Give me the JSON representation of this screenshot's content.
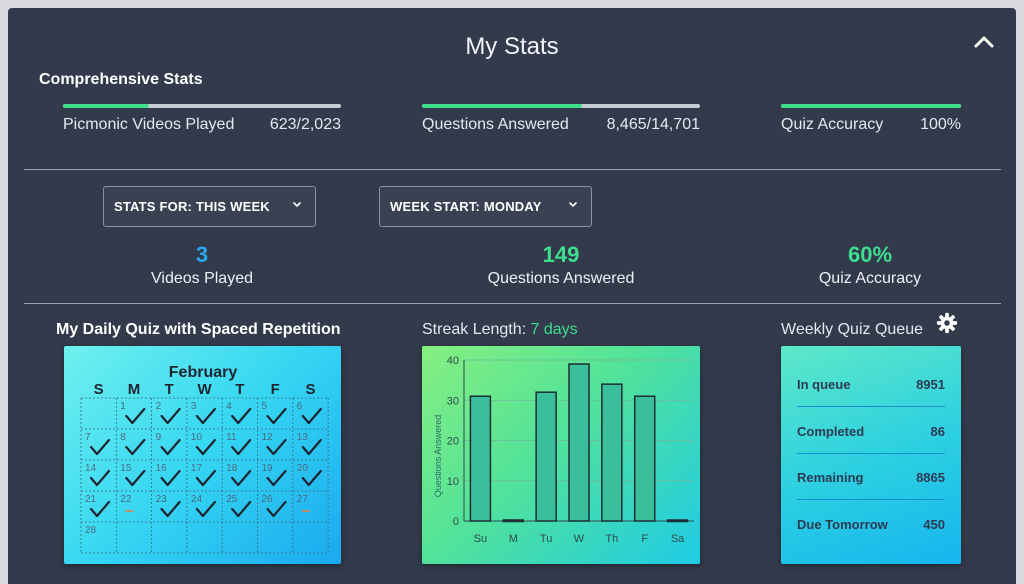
{
  "header": {
    "title": "My Stats"
  },
  "comprehensive": {
    "heading": "Comprehensive Stats",
    "metrics": [
      {
        "label": "Picmonic Videos Played",
        "value": "623/2,023",
        "progress": 0.308
      },
      {
        "label": "Questions Answered",
        "value": "8,465/14,701",
        "progress": 0.576
      },
      {
        "label": "Quiz Accuracy",
        "value": "100%",
        "progress": 1.0
      }
    ]
  },
  "filters": {
    "stats_for": "STATS FOR: THIS WEEK",
    "week_start": "WEEK START: MONDAY"
  },
  "weekly": {
    "videos_played": {
      "value": "3",
      "label": "Videos Played",
      "color": "#2aa7ef"
    },
    "questions_answered": {
      "value": "149",
      "label": "Questions Answered",
      "color": "#3ddf8e"
    },
    "quiz_accuracy": {
      "value": "60%",
      "label": "Quiz Accuracy",
      "color": "#3ddf8e"
    }
  },
  "calendar": {
    "title": "My Daily Quiz with Spaced Repetition",
    "month": "February",
    "weekdays": [
      "S",
      "M",
      "T",
      "W",
      "T",
      "F",
      "S"
    ],
    "days": [
      {
        "d": "1",
        "s": "done"
      },
      {
        "d": "2",
        "s": "done"
      },
      {
        "d": "3",
        "s": "done"
      },
      {
        "d": "4",
        "s": "done"
      },
      {
        "d": "5",
        "s": "done"
      },
      {
        "d": "6",
        "s": "done"
      },
      {
        "d": "7",
        "s": "done"
      },
      {
        "d": "8",
        "s": "done"
      },
      {
        "d": "9",
        "s": "done"
      },
      {
        "d": "10",
        "s": "done"
      },
      {
        "d": "11",
        "s": "done"
      },
      {
        "d": "12",
        "s": "done"
      },
      {
        "d": "13",
        "s": "done"
      },
      {
        "d": "14",
        "s": "done"
      },
      {
        "d": "15",
        "s": "done"
      },
      {
        "d": "16",
        "s": "done"
      },
      {
        "d": "17",
        "s": "done"
      },
      {
        "d": "18",
        "s": "done"
      },
      {
        "d": "19",
        "s": "done"
      },
      {
        "d": "20",
        "s": "done"
      },
      {
        "d": "21",
        "s": "done"
      },
      {
        "d": "22",
        "s": "missed"
      },
      {
        "d": "23",
        "s": "done"
      },
      {
        "d": "24",
        "s": "done"
      },
      {
        "d": "25",
        "s": "done"
      },
      {
        "d": "26",
        "s": "done"
      },
      {
        "d": "27",
        "s": "missed"
      },
      {
        "d": "28",
        "s": "none"
      }
    ],
    "first_weekday": 1,
    "check_color": "#1f2530",
    "missed_color": "#e0854a"
  },
  "streak": {
    "label": "Streak Length:",
    "value": "7 days",
    "value_color": "#3ddf8e"
  },
  "chart_data": {
    "type": "bar",
    "categories": [
      "Su",
      "M",
      "Tu",
      "W",
      "Th",
      "F",
      "Sa"
    ],
    "values": [
      31,
      0,
      32,
      39,
      34,
      31,
      0
    ],
    "ylabel": "Questions Answered",
    "ylim": [
      0,
      40
    ],
    "yticks": [
      "0",
      "10",
      "20",
      "30",
      "40"
    ],
    "grid": true,
    "bar_color": "#3bbf9a"
  },
  "queue": {
    "title": "Weekly Quiz Queue",
    "rows": [
      {
        "label": "In queue",
        "value": "8951"
      },
      {
        "label": "Completed",
        "value": "86"
      },
      {
        "label": "Remaining",
        "value": "8865"
      },
      {
        "label": "Due Tomorrow",
        "value": "450"
      }
    ]
  }
}
